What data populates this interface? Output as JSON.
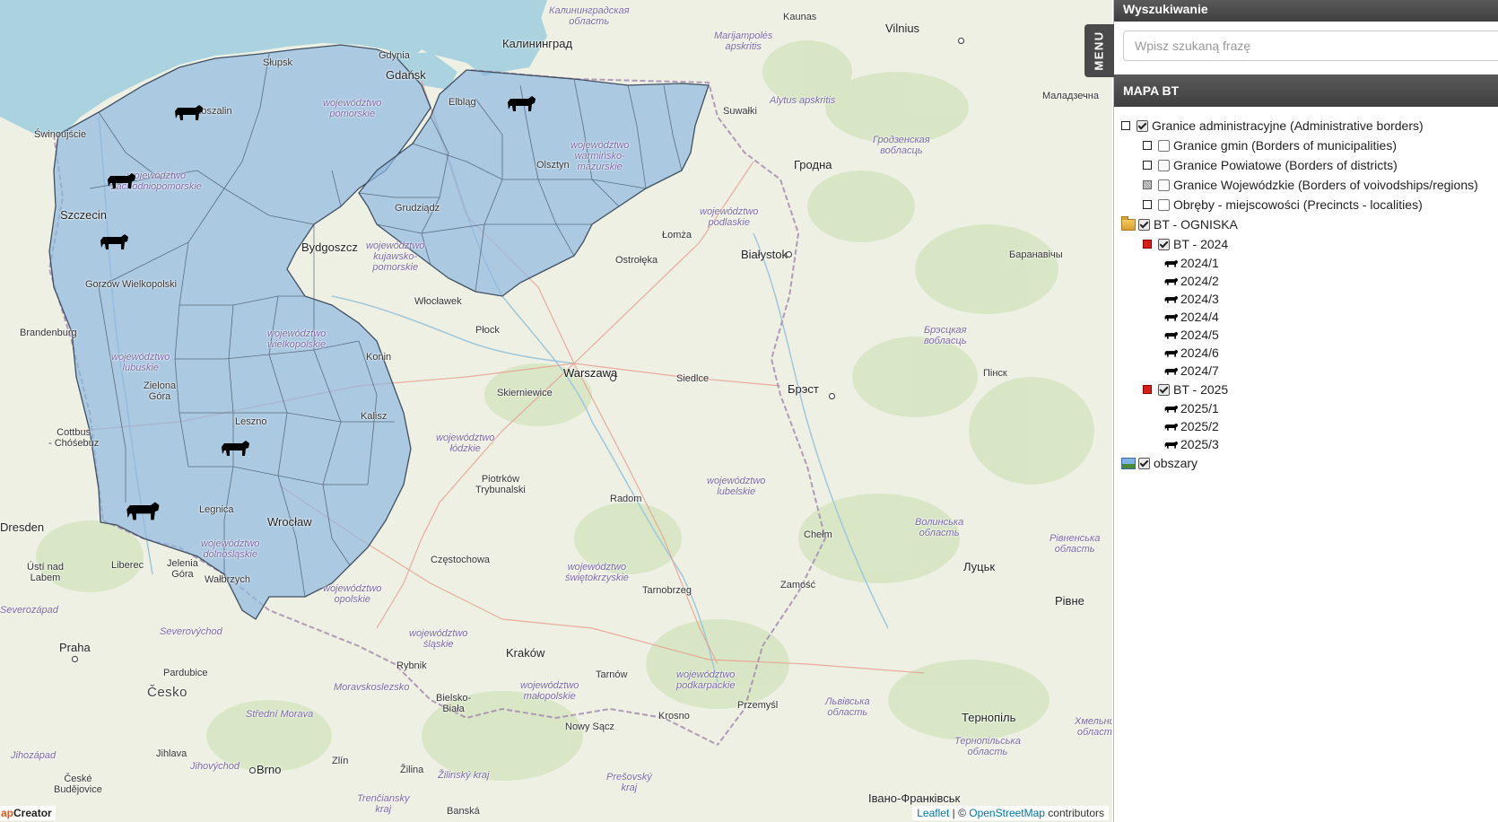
{
  "sidebar": {
    "search": {
      "header": "Wyszukiwanie",
      "placeholder": "Wpisz szukaną frazę"
    },
    "menu_tab": "MENU",
    "map_panel": {
      "header": "MAPA BT",
      "layers": {
        "admin": {
          "label": "Granice administracyjne (Administrative borders)",
          "checked": true
        },
        "gmin": {
          "label": "Granice gmin (Borders of municipalities)",
          "checked": false
        },
        "powiat": {
          "label": "Granice Powiatowe (Borders of districts)",
          "checked": false
        },
        "woj": {
          "label": "Granice Wojewódzkie (Borders of voivodships/regions)",
          "checked": false
        },
        "obreby": {
          "label": "Obręby - miejscowości (Precincts - localities)",
          "checked": false
        },
        "ogniska": {
          "label": "BT - OGNISKA",
          "checked": true
        },
        "bt2024": {
          "label": "BT - 2024",
          "checked": true,
          "items": [
            "2024/1",
            "2024/2",
            "2024/3",
            "2024/4",
            "2024/5",
            "2024/6",
            "2024/7"
          ]
        },
        "bt2025": {
          "label": "BT - 2025",
          "checked": true,
          "items": [
            "2025/1",
            "2025/2",
            "2025/3"
          ]
        },
        "obszary": {
          "label": "obszary",
          "checked": true
        }
      }
    }
  },
  "map": {
    "attribution": {
      "leaflet": "Leaflet",
      "separator": " | © ",
      "osm": "OpenStreetMap",
      "suffix": " contributors"
    },
    "brand": {
      "accent": "ap",
      "rest": "Creator"
    },
    "colors": {
      "land": "#eef0e4",
      "sea": "#aad3df",
      "affected_area": "#8fb8e0",
      "affected_border": "#3f4f60",
      "border": "#a58bb0"
    },
    "labels": {
      "kaliningrad_obl": "Калининградская\nобласть",
      "kaunas": "Kaunas",
      "vilnius": "Vilnius",
      "marijampole": "Marijampolės\napskritis",
      "kaliningrad": "Калининград",
      "alytus": "Alytus apskritis",
      "malazechna": "Маладзечна",
      "slupsk": "Słupsk",
      "gdynia": "Gdynia",
      "gdansk": "Gdańsk",
      "elblag": "Elbląg",
      "suwalki": "Suwałki",
      "koszalin": "Koszalin",
      "pomorskie": "województwo\npomorskie",
      "warminsko": "województwo\nwarmińsko-\nmazurskie",
      "grodno_obl": "Гродзенская\nвобласць",
      "swinoujscie": "Świnoujście",
      "zachodnio": "województwo\nzachodniopomorskie",
      "olsztyn": "Olsztyn",
      "grodno": "Гродна",
      "szczecin": "Szczecin",
      "grudziadz": "Grudziądz",
      "podlaskie": "województwo\npodlaskie",
      "lomza": "Łomża",
      "bydgoszcz": "Bydgoszcz",
      "kujawsko": "województwo\nkujawsko-\npomorskie",
      "bialystok": "Białystok",
      "baranavichy": "Баранавічы",
      "gorzow": "Gorzów\nWielkopolski",
      "ostroleka": "Ostrołęka",
      "wloclawek": "Włocławek",
      "brandenburg": "Brandenburg",
      "plock": "Płock",
      "wielkopolskie": "województwo\nwielkopolskie",
      "lubuskie": "województwo\nlubuskie",
      "brest_obl": "Брэсцкая\nвобласць",
      "konin": "Konin",
      "warszawa": "Warszawa",
      "siedlce": "Siedlce",
      "pinsk": "Пінск",
      "zielona": "Zielona\nGóra",
      "skierniewice": "Skierniewice",
      "brest": "Брэст",
      "leszno": "Leszno",
      "kalisz": "Kalisz",
      "lodzkie": "województwo\nłódzkie",
      "cottbus": "Cottbus\n- Chóśebuz",
      "lubelskie": "województwo\nlubelskie",
      "piotrkow": "Piotrków\nTrybunalski",
      "radom": "Radom",
      "dresden": "Dresden",
      "legnica": "Legnica",
      "wroclaw": "Wrocław",
      "chelm": "Chełm",
      "volyn_obl": "Волинська\nобласть",
      "rivne_obl": "Рівненська\nобласть",
      "czestochowa": "Częstochowa",
      "swietokrzyskie": "województwo\nświętokrzyskie",
      "dolnoslaskie": "województwo\ndolnośląskie",
      "liberec": "Liberec",
      "jelenia": "Jelenia\nGóra",
      "usti": "Ústí nad\nLabem",
      "walbrzych": "Wałbrzych",
      "opolskie": "województwo\nopolskie",
      "zamosc": "Zamość",
      "lutsk": "Луцьк",
      "tarnobrzeg": "Tarnobrzeg",
      "rivne": "Рівне",
      "severozapad": "Severozápad",
      "severovychod": "Severovýchod",
      "slaskie": "województwo\nśląskie",
      "praha": "Praha",
      "krakow": "Kraków",
      "rybnik": "Rybnik",
      "pardubice": "Pardubice",
      "tarnow": "Tarnów",
      "podkarpackie": "województwo\npodkarpackie",
      "moravskoslezsko": "Moravskoslezsko",
      "malopolskie": "województwo\nmałopolskie",
      "cesko": "Česko",
      "bielsko": "Bielsko-\nBiała",
      "przemysl": "Przemyśl",
      "lviv_obl": "Львівська\nобласть",
      "stredni_morava": "Střední Morava",
      "krosno": "Krosno",
      "ternopil": "Тернопіль",
      "nowy_sacz": "Nowy Sącz",
      "khmelnytsk": "Хмельни\nобласт",
      "ternopil_obl": "Тернопільська\nобласть",
      "jihozapad": "Jihozápad",
      "jihlava": "Jihlava",
      "jihovychod": "Jihovýchod",
      "brno": "Brno",
      "zlin": "Zlín",
      "zilina": "Žilina",
      "zilinsky": "Žilinský kraj",
      "presovsky": "Prešovský\nkraj",
      "ceske": "České\nBudějovice",
      "trenciansky": "Trenčiansky\nkraj",
      "banska": "Banská",
      "ivano": "Івано-Франківськ"
    }
  }
}
